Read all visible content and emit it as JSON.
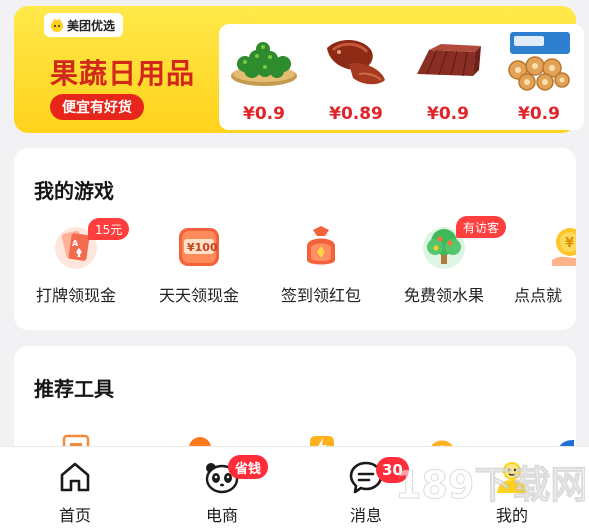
{
  "banner": {
    "brand": "美团优选",
    "title": "果蔬日用品",
    "pill": "便宜有好货",
    "bg_color": "#ffd21c",
    "products": [
      {
        "name": "limes-basket",
        "price": "¥0.9"
      },
      {
        "name": "braised-duck",
        "price": "¥0.89"
      },
      {
        "name": "jelly-block",
        "price": "¥0.9"
      },
      {
        "name": "biscuits",
        "price": "¥0.9"
      }
    ]
  },
  "games": {
    "title": "我的游戏",
    "items": [
      {
        "label": "打牌领现金",
        "icon": "poker-card-icon",
        "badge": "15元"
      },
      {
        "label": "天天领现金",
        "icon": "cash-100-icon",
        "badge": ""
      },
      {
        "label": "签到领红包",
        "icon": "red-packet-bag-icon",
        "badge": ""
      },
      {
        "label": "免费领水果",
        "icon": "fruit-tree-icon",
        "badge": "有访客"
      },
      {
        "label": "点点就",
        "icon": "coin-hand-icon",
        "badge": ""
      }
    ]
  },
  "tools": {
    "title": "推荐工具"
  },
  "tabbar": {
    "items": [
      {
        "label": "首页",
        "icon": "home-icon",
        "badge": ""
      },
      {
        "label": "电商",
        "icon": "panda-icon",
        "badge": "省钱"
      },
      {
        "label": "消息",
        "icon": "message-bubble-icon",
        "badge": "30"
      },
      {
        "label": "我的",
        "icon": "profile-icon",
        "badge": ""
      }
    ]
  },
  "watermark": "189下载网",
  "colors": {
    "accent_red": "#e1232a",
    "badge_red": "#ff3e3e",
    "brand_yellow": "#ffd21c"
  }
}
